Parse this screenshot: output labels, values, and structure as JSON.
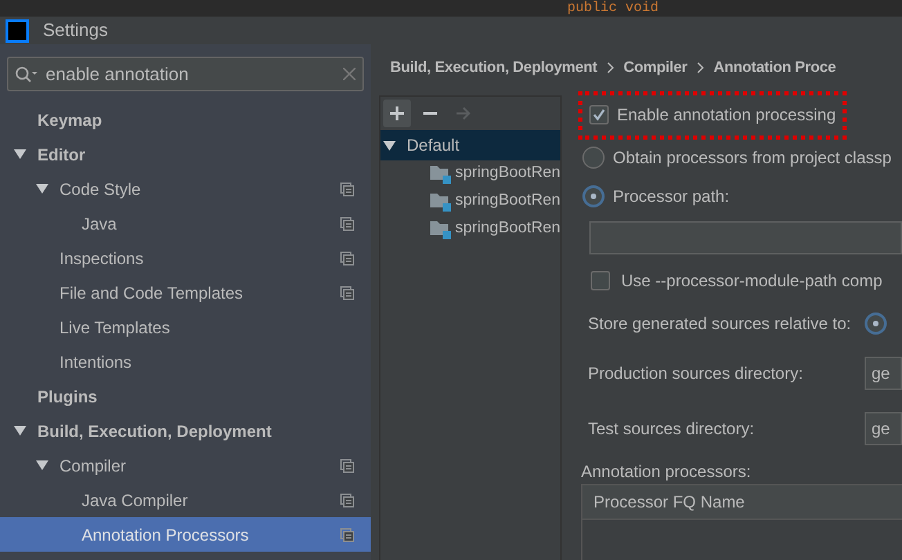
{
  "editor_strip": {
    "code": "public void"
  },
  "window": {
    "title": "Settings"
  },
  "search": {
    "value": "enable annotation"
  },
  "sidebar": {
    "items": [
      {
        "label": "Keymap",
        "bold": true,
        "selected": false,
        "project_scope": false
      },
      {
        "label": "Editor",
        "bold": true,
        "expanded": true,
        "selected": false,
        "project_scope": false,
        "children": [
          {
            "label": "Code Style",
            "bold": false,
            "expanded": true,
            "selected": false,
            "project_scope": true,
            "children": [
              {
                "label": "Java",
                "bold": false,
                "selected": false,
                "project_scope": true
              }
            ]
          },
          {
            "label": "Inspections",
            "bold": false,
            "selected": false,
            "project_scope": true
          },
          {
            "label": "File and Code Templates",
            "bold": false,
            "selected": false,
            "project_scope": true
          },
          {
            "label": "Live Templates",
            "bold": false,
            "selected": false,
            "project_scope": false
          },
          {
            "label": "Intentions",
            "bold": false,
            "selected": false,
            "project_scope": false
          }
        ]
      },
      {
        "label": "Plugins",
        "bold": true,
        "selected": false,
        "project_scope": false
      },
      {
        "label": "Build, Execution, Deployment",
        "bold": true,
        "expanded": true,
        "selected": false,
        "project_scope": false,
        "children": [
          {
            "label": "Compiler",
            "bold": false,
            "expanded": true,
            "selected": false,
            "project_scope": true,
            "children": [
              {
                "label": "Java Compiler",
                "bold": false,
                "selected": false,
                "project_scope": true
              },
              {
                "label": "Annotation Processors",
                "bold": false,
                "selected": true,
                "project_scope": true
              }
            ]
          }
        ]
      }
    ]
  },
  "breadcrumb": [
    "Build, Execution, Deployment",
    "Compiler",
    "Annotation Proce"
  ],
  "profiles": {
    "toolbar": [
      {
        "kind": "add",
        "disabled": false
      },
      {
        "kind": "remove",
        "disabled": false
      },
      {
        "kind": "move",
        "disabled": true
      }
    ],
    "items": [
      {
        "label": "Default",
        "expanded": true,
        "selected": true,
        "children": [
          {
            "label": "springBootRen",
            "selected": false
          },
          {
            "label": "springBootRen",
            "selected": false
          },
          {
            "label": "springBootRen",
            "selected": false
          }
        ]
      }
    ]
  },
  "settings": {
    "enable": {
      "label": "Enable annotation processing",
      "checked": true,
      "highlighted": true
    },
    "source_options": [
      {
        "label": "Obtain processors from project classp",
        "selected": false
      },
      {
        "label": "Processor path:",
        "selected": true
      }
    ],
    "module_path": {
      "label": "Use --processor-module-path comp",
      "checked": false
    },
    "store_relative": {
      "label": "Store generated sources relative to:",
      "selected": true
    },
    "directories": [
      {
        "label": "Production sources directory:",
        "value": "ge"
      },
      {
        "label": "Test sources directory:",
        "value": "ge"
      }
    ],
    "processors": {
      "label": "Annotation processors:",
      "columns": [
        "Processor FQ Name"
      ]
    }
  }
}
